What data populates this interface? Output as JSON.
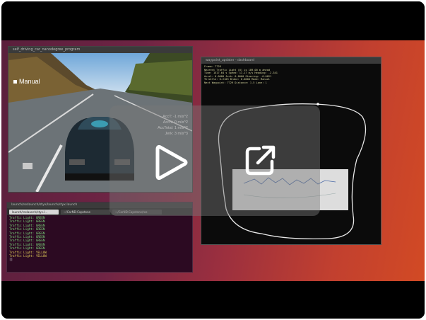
{
  "simulator": {
    "title": "self_driving_car_nanodegree_program",
    "mode_label": "Manual",
    "stats": [
      "AccT: -1 m/s^2",
      "AccN: 0 m/s^2",
      "AccTotal: 1 m/s^2",
      "Jerk: 3 m/s^3"
    ]
  },
  "terminal": {
    "title": "launch/roslaunch/styx/launch/styx.launch",
    "tabs": [
      "launch/roslaunch/styx.l...",
      "~/CarND-Capstone",
      "~/CarND-Capstone/ros"
    ],
    "lines": [
      {
        "text": "Traffic Light: GREEN",
        "color": "green"
      },
      {
        "text": "Traffic Light: GREEN",
        "color": "green"
      },
      {
        "text": "Traffic Light: GREEN",
        "color": "green"
      },
      {
        "text": "Traffic Light: GREEN",
        "color": "green"
      },
      {
        "text": "Traffic Light: GREEN",
        "color": "green"
      },
      {
        "text": "Traffic Light: GREEN",
        "color": "green"
      },
      {
        "text": "Traffic Light: GREEN",
        "color": "green"
      },
      {
        "text": "Traffic Light: GREEN",
        "color": "green"
      },
      {
        "text": "Traffic Light: GREEN",
        "color": "green"
      },
      {
        "text": "Traffic Light: YELLOW",
        "color": "yellow"
      },
      {
        "text": "Traffic Light: YELLOW",
        "color": "yellow"
      }
    ],
    "prompt": "[]"
  },
  "plot_window": {
    "title": "waypoint_updater - dashboard",
    "info_lines": [
      "Frame: 7728",
      "Nearest Traffic Light (0) is 189.00 m ahead",
      "Time: 1517.64 s  Speed: 11.17 m/s  Heading: -2.341",
      "Accel: 0.0000  Jerk: 0.0000  Steering: -0.0021",
      "Throttle: 0.2103  Brake: 0.0000  Mode: Manual",
      "Next Waypoint: 7729  Distance: 1.5  Lane: 1"
    ]
  },
  "player": {
    "play_icon": "play-icon",
    "share_icon": "share-icon"
  }
}
